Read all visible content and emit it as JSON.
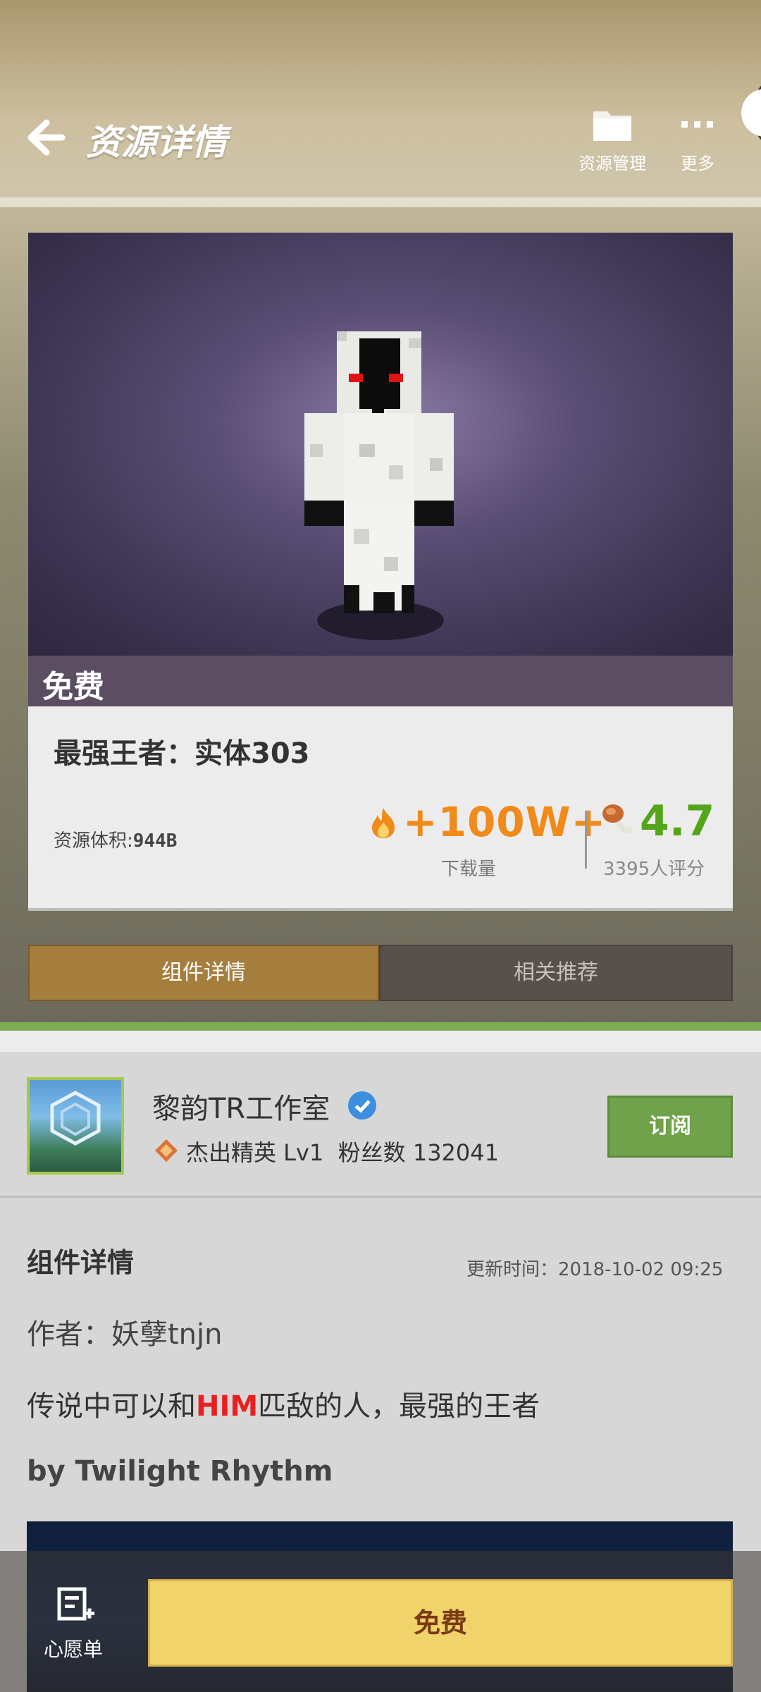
{
  "header": {
    "title": "资源详情",
    "resource_manage_label": "资源管理",
    "more_label": "更多"
  },
  "resource": {
    "price_badge": "免费",
    "title": "最强王者：实体303",
    "size_label": "资源体积:",
    "size_value": "944B",
    "downloads_value": "+100W+",
    "downloads_label": "下载量",
    "rating_value": "4.7",
    "rating_label": "3395人评分"
  },
  "tabs": [
    {
      "label": "组件详情",
      "active": true
    },
    {
      "label": "相关推荐",
      "active": false
    }
  ],
  "creator": {
    "name": "黎韵TR工作室",
    "level": "杰出精英 Lv1",
    "followers": "粉丝数 132041",
    "subscribe_label": "订阅"
  },
  "details": {
    "section_title": "组件详情",
    "update_time": "更新时间：2018-10-02 09:25",
    "author": "作者：妖孽tnjn",
    "desc_before": "传说中可以和",
    "desc_highlight": "HIM",
    "desc_after": "匹敌的人，最强的王者",
    "byline": "by Twilight Rhythm"
  },
  "bottom": {
    "wishlist_label": "心愿单",
    "action_label": "免费"
  },
  "colors": {
    "accent_orange": "#f08a1a",
    "rating_green": "#55a51a",
    "subscribe_green": "#6fa24a",
    "free_button_yellow": "#f0d36a",
    "highlight_red": "#e82020"
  }
}
